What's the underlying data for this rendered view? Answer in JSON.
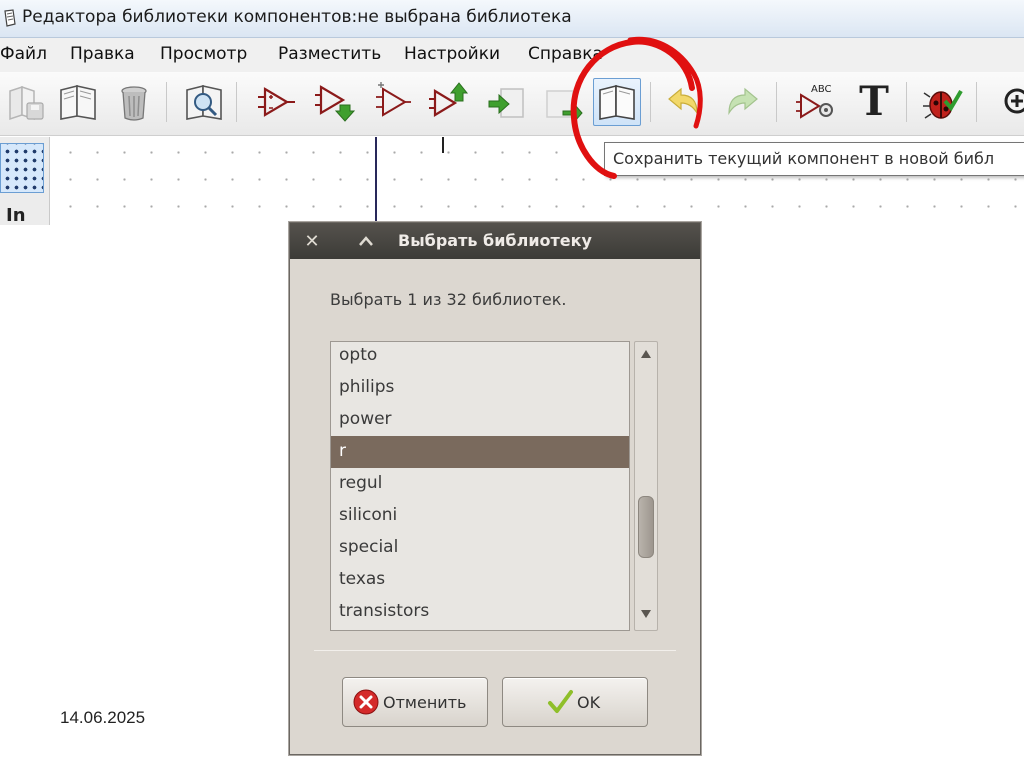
{
  "window": {
    "title": "Редактора библиотеки компонентов:не выбрана библиотека"
  },
  "menu": {
    "items": [
      "Файл",
      "Правка",
      "Просмотр",
      "Разместить",
      "Настройки",
      "Справка"
    ]
  },
  "toolbar": {
    "buttons": [
      "save-library-icon",
      "open-library-icon",
      "delete-component-icon",
      "library-browser-icon",
      "new-component-icon",
      "load-component-icon",
      "component-plus-icon",
      "export-component-icon",
      "import-component-icon",
      "save-component-icon",
      "save-to-new-library-icon",
      "undo-icon",
      "redo-icon",
      "edit-component-properties-icon",
      "text-tool-icon",
      "erc-bug-icon",
      "zoom-in-icon"
    ],
    "selected_button": "save-to-new-library-icon",
    "tooltip": "Сохранить текущий компонент в новой библ"
  },
  "canvas": {
    "left_label": "In"
  },
  "dialog": {
    "title": "Выбрать библиотеку",
    "prompt": "Выбрать 1 из 32 библиотек.",
    "list_items": [
      "opto",
      "philips",
      "power",
      "r",
      "regul",
      "siliconi",
      "special",
      "texas",
      "transistors"
    ],
    "selected_item": "r",
    "scroll_position": 0.74,
    "cancel_label": "Отменить",
    "ok_label": "OK"
  },
  "slide": {
    "date": "14.06.2025"
  },
  "colors": {
    "annotation_circle": "#e01010",
    "list_selection": "#7a6a5d",
    "dialog_title_bar": "#3c3b37",
    "dialog_background": "#dcd7d0"
  }
}
